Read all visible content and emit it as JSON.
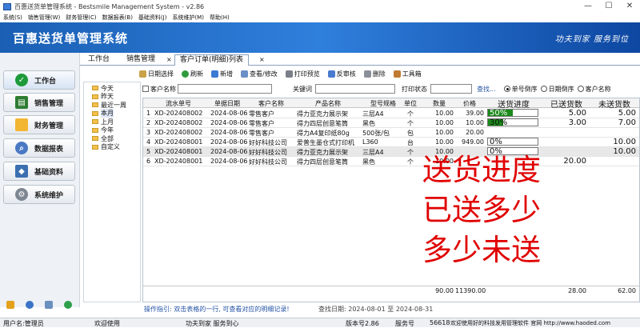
{
  "window": {
    "title": "百惠送货单管理系统 - Bestsmile Management System - v2.86",
    "min": "—",
    "max": "☐",
    "close": "✕"
  },
  "menu": [
    "系统(S)",
    "销售管理(W)",
    "财务管理(C)",
    "数据报表(B)",
    "基础资料(J)",
    "系统维护(M)",
    "帮助(H)"
  ],
  "banner": {
    "brand": "百惠送货单管理系统",
    "slogan": "功夫到家 服务到位"
  },
  "sidebar": {
    "items": [
      {
        "label": "工作台",
        "icon": "checkmark-icon"
      },
      {
        "label": "销售管理",
        "icon": "sales-icon"
      },
      {
        "label": "财务管理",
        "icon": "folder-icon"
      },
      {
        "label": "数据报表",
        "icon": "search-report-icon"
      },
      {
        "label": "基础资料",
        "icon": "basic-data-icon"
      },
      {
        "label": "系统维护",
        "icon": "gear-icon"
      }
    ]
  },
  "tabs": [
    {
      "label": "工作台"
    },
    {
      "label": "销售管理"
    },
    {
      "label": "客户订单(明细)列表"
    }
  ],
  "tab_close": "×",
  "toolbar": [
    "日期选择",
    "刷新",
    "新增",
    "查看/修改",
    "打印预览",
    "反审核",
    "删除",
    "工具箱"
  ],
  "tree": [
    "今天",
    "昨天",
    "最近一周",
    "本月",
    "上月",
    "今年",
    "全部",
    "自定义"
  ],
  "filters": {
    "customer_label": "客户名称",
    "keyword_label": "关键词",
    "print_status_label": "打印状态",
    "search_label": "查找...",
    "radios": [
      "单号倒序",
      "日期倒序",
      "客户名称"
    ]
  },
  "columns": [
    "流水单号",
    "单据日期",
    "客户名称",
    "产品名称",
    "型号规格",
    "单位",
    "数量",
    "价格",
    "送货进度",
    "已送货数",
    "未送货数"
  ],
  "rows": [
    {
      "no": "1",
      "order": "XD-202408002",
      "date": "2024-08-06",
      "customer": "零售客户",
      "product": "得力亚克力展示架",
      "spec": "三层A4",
      "unit": "个",
      "qty": "10.00",
      "price": "39.00",
      "progress": "50%",
      "progress_value": 0.5,
      "delivered": "5.00",
      "undelivered": "5.00"
    },
    {
      "no": "2",
      "order": "XD-202408002",
      "date": "2024-08-06",
      "customer": "零售客户",
      "product": "得力四层创意笔筒",
      "spec": "黑色",
      "unit": "个",
      "qty": "10.00",
      "price": "10.00",
      "progress": "30%",
      "progress_value": 0.3,
      "delivered": "3.00",
      "undelivered": "7.00"
    },
    {
      "no": "3",
      "order": "XD-202408002",
      "date": "2024-08-06",
      "customer": "零售客户",
      "product": "得力A4复印纸80g",
      "spec": "500张/包",
      "unit": "包",
      "qty": "10.00",
      "price": "20.00",
      "progress": "",
      "progress_value": null,
      "delivered": "",
      "undelivered": ""
    },
    {
      "no": "4",
      "order": "XD-202408001",
      "date": "2024-08-06",
      "customer": "好好科技公司",
      "product": "爱普生墨仓式打印机",
      "spec": "L360",
      "unit": "台",
      "qty": "10.00",
      "price": "949.00",
      "progress": "0%",
      "progress_value": 0,
      "delivered": "",
      "undelivered": "10.00"
    },
    {
      "no": "5",
      "order": "XD-202408001",
      "date": "2024-08-06",
      "customer": "好好科技公司",
      "product": "得力亚克力展示架",
      "spec": "三层A4",
      "unit": "个",
      "qty": "10.00",
      "price": "",
      "progress": "0%",
      "progress_value": 0,
      "delivered": "",
      "undelivered": "10.00"
    },
    {
      "no": "6",
      "order": "XD-202408001",
      "date": "2024-08-06",
      "customer": "好好科技公司",
      "product": "得力四层创意笔筒",
      "spec": "黑色",
      "unit": "个",
      "qty": "10.00",
      "price": "",
      "progress": "",
      "progress_value": null,
      "delivered": "20.00",
      "undelivered": ""
    }
  ],
  "totals": {
    "qty": "90.00",
    "amount": "11390.00",
    "delivered": "28.00",
    "undelivered": "62.00"
  },
  "annotation": [
    "送货进度",
    "已送多少",
    "多少未送"
  ],
  "info": {
    "hint": "操作指引: 双击表格的一行, 可查看对应的明细记录!",
    "range": "查找日期: 2024-08-01 至 2024-08-31"
  },
  "status": {
    "user": "用户名:管理员",
    "welcome": "欢迎使用",
    "motto": "功夫到家 服务到心",
    "version": "版本号2.86",
    "service_label": "服务号",
    "service_no": "56618",
    "website": "欢迎使用好的科技发用管理软件 官网 http://www.haoded.com"
  },
  "colors": {
    "banner": "#1a5fb4",
    "progress": "#1a8a1a",
    "annotation": "#e00000"
  }
}
